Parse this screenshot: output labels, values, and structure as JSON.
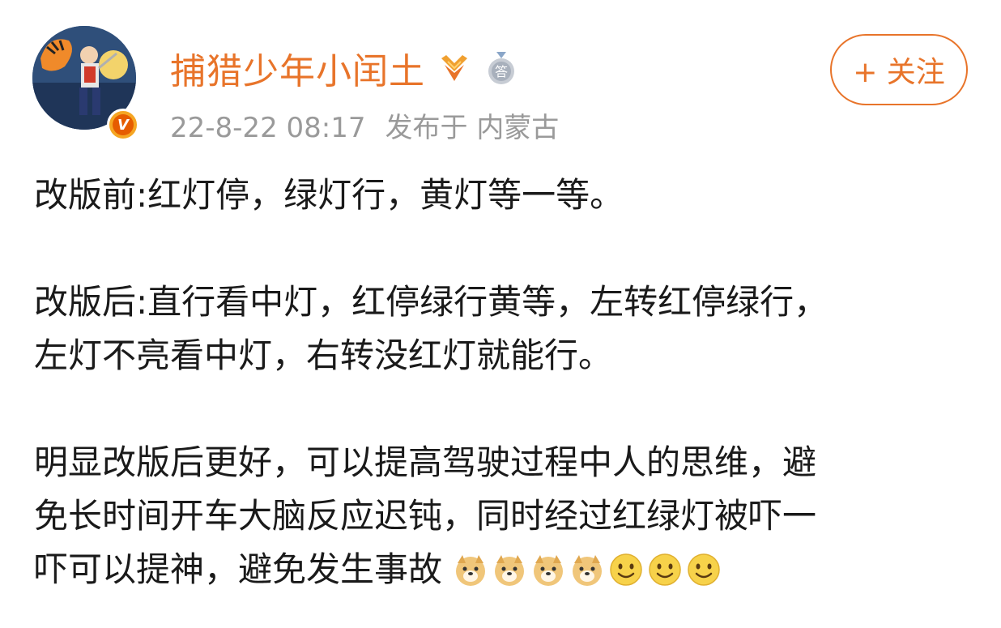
{
  "header": {
    "username": "捕猎少年小闰土",
    "timestamp": "22-8-22 08:17",
    "published_label": "发布于",
    "location": "内蒙古",
    "follow_label": "+ 关注",
    "verified_icon": "verified-v-icon",
    "badges": [
      "gold-medal-icon",
      "silver-medal-icon"
    ],
    "accent_color": "#e8742a"
  },
  "post": {
    "paragraph_1": "改版前:红灯停，绿灯行，黄灯等一等。",
    "paragraph_2_line_1": "改版后:直行看中灯，红停绿行黄等，左转红停绿行，",
    "paragraph_2_line_2": "左灯不亮看中灯，右转没红灯就能行。",
    "paragraph_3_line_1": "明显改版后更好，可以提高驾驶过程中人的思维，避",
    "paragraph_3_line_2": "免长时间开车大脑反应迟钝，同时经过红绿灯被吓一",
    "paragraph_3_line_3": "吓可以提神，避免发生事故",
    "trailing_emojis": [
      "doge-emoji",
      "doge-emoji",
      "doge-emoji",
      "doge-emoji",
      "smile-emoji",
      "smile-emoji",
      "smile-emoji"
    ]
  }
}
